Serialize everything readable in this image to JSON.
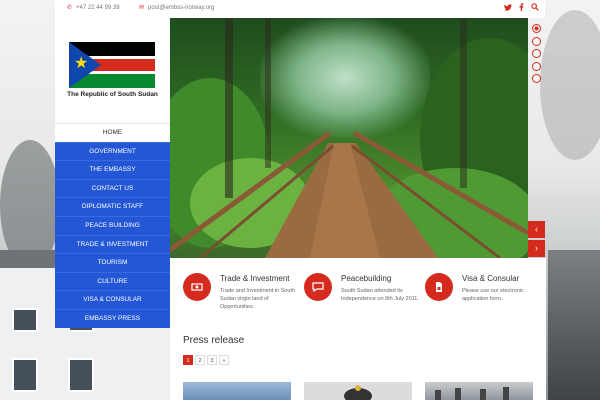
{
  "topbar": {
    "phone": "+47 22 44 99 39",
    "email": "post@embss-norway.org",
    "social_icons": [
      "twitter-icon",
      "facebook-icon",
      "search-icon"
    ]
  },
  "brand": {
    "caption": "The Republic of South Sudan"
  },
  "menu": {
    "items": [
      {
        "label": "HOME",
        "active": true
      },
      {
        "label": "GOVERNMENT",
        "active": false
      },
      {
        "label": "THE EMBASSY",
        "active": false
      },
      {
        "label": "CONTACT US",
        "active": false
      },
      {
        "label": "DIPLOMATIC STAFF",
        "active": false
      },
      {
        "label": "PEACE BUILDING",
        "active": false
      },
      {
        "label": "TRADE & INVESTMENT",
        "active": false
      },
      {
        "label": "TOURISM",
        "active": false
      },
      {
        "label": "CULTURE",
        "active": false
      },
      {
        "label": "VISA & CONSULAR",
        "active": false
      },
      {
        "label": "EMBASSY PRESS",
        "active": false
      }
    ]
  },
  "hero": {
    "prev_glyph": "‹",
    "next_glyph": "›",
    "slide_count": 5,
    "active_slide": 0
  },
  "features": [
    {
      "title": "Trade & Investment",
      "desc": "Trade and Investment in South Sudan virgin land of Opportunities.",
      "icon": "money-icon"
    },
    {
      "title": "Peacebuilding",
      "desc": "South Sudan attended its Independence on 9th July 2011.",
      "icon": "chat-icon"
    },
    {
      "title": "Visa & Consular",
      "desc": "Please use our electronic application form.",
      "icon": "document-icon"
    }
  ],
  "press": {
    "title": "Press release",
    "pages": [
      "1",
      "2",
      "3",
      "»"
    ],
    "active_page": "1"
  },
  "colors": {
    "accent": "#d42b1e",
    "menu_blue": "#2457d6"
  }
}
